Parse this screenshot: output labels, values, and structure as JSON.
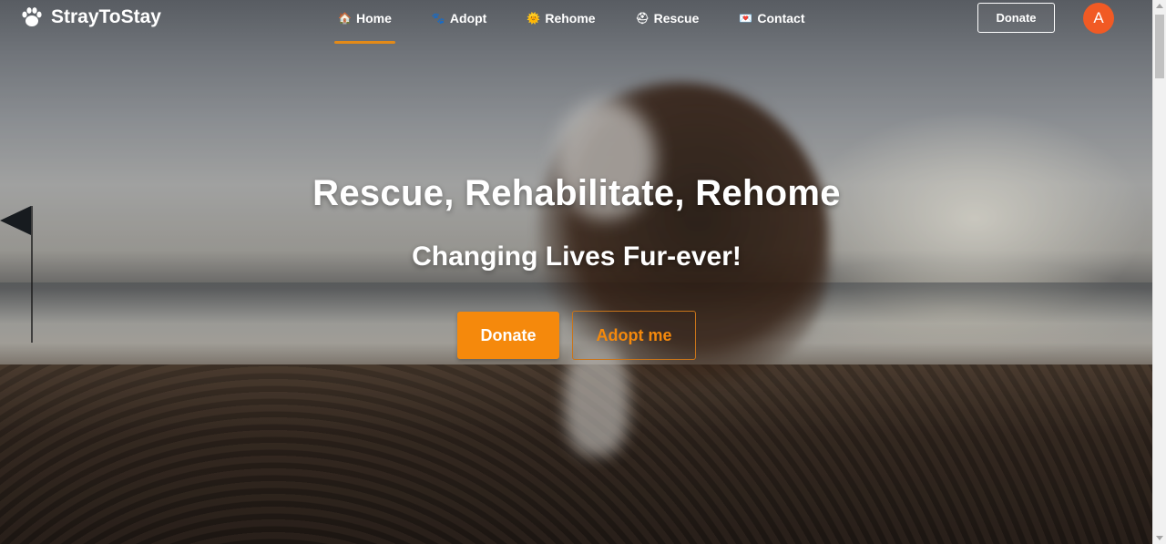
{
  "brand": {
    "name": "StrayToStay",
    "icon": "paw-icon"
  },
  "nav": {
    "items": [
      {
        "label": "Home",
        "icon": "house-icon",
        "glyph": "🏠",
        "active": true
      },
      {
        "label": "Adopt",
        "icon": "paw-prints-icon",
        "glyph": "🐾",
        "active": false
      },
      {
        "label": "Rehome",
        "icon": "sun-icon",
        "glyph": "🌞",
        "active": false
      },
      {
        "label": "Rescue",
        "icon": "rescue-helmet-icon",
        "glyph": "⛑",
        "active": false
      },
      {
        "label": "Contact",
        "icon": "love-letter-icon",
        "glyph": "💌",
        "active": false
      }
    ],
    "donate_label": "Donate",
    "avatar_initial": "A"
  },
  "hero": {
    "title": "Rescue, Rehabilitate, Rehome",
    "subtitle": "Changing Lives Fur-ever!",
    "donate_label": "Donate",
    "adopt_label": "Adopt me"
  },
  "colors": {
    "accent": "#f5890c",
    "avatar": "#f15a24",
    "active_underline": "#e38a18"
  }
}
